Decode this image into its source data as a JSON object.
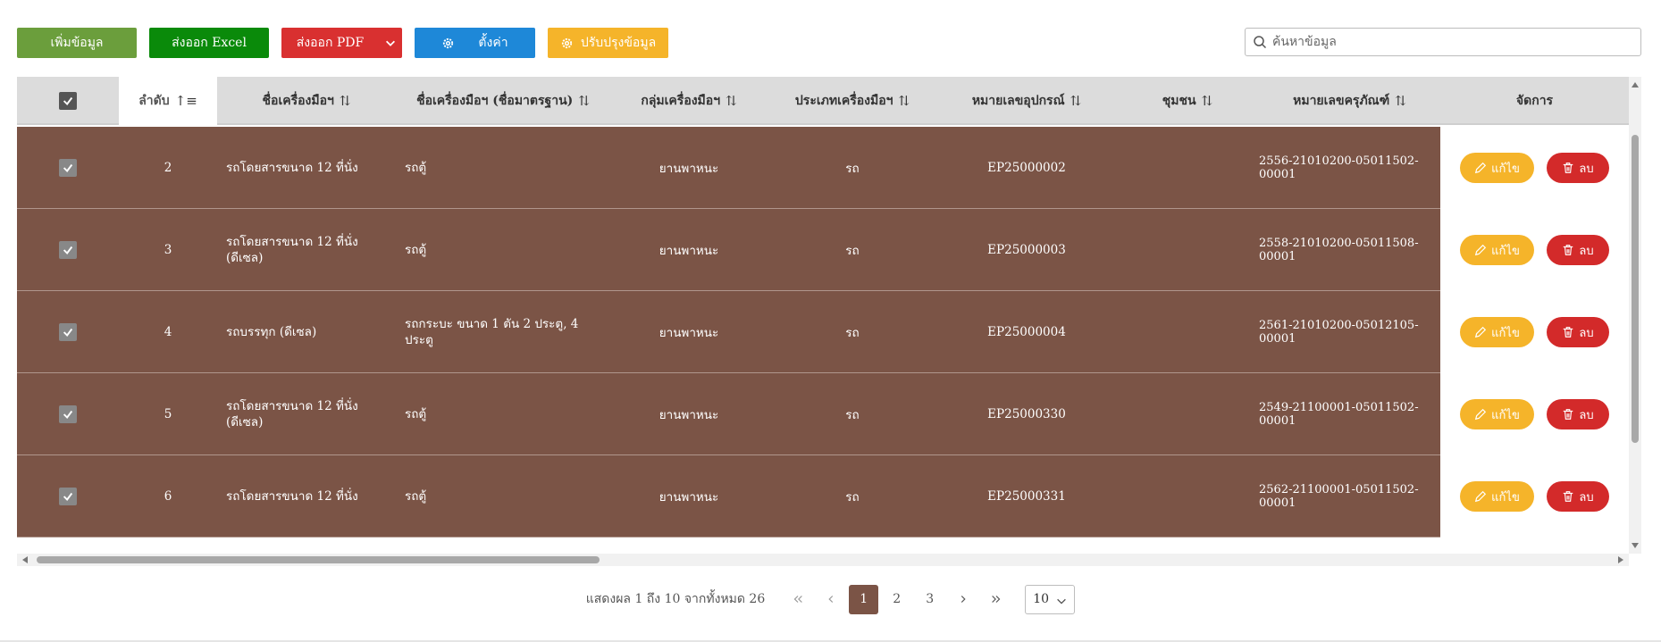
{
  "toolbar": {
    "add_label": "เพิ่มข้อมูล",
    "excel_label": "ส่งออก Excel",
    "pdf_label": "ส่งออก PDF",
    "settings_label": "ตั้งค่า",
    "update_label": "ปรับปรุงข้อมูล"
  },
  "search": {
    "placeholder": "ค้นหาข้อมูล"
  },
  "table": {
    "headers": {
      "order": "ลำดับ",
      "name": "ชื่อเครื่องมือฯ",
      "std_name": "ชื่อเครื่องมือฯ (ชื่อมาตรฐาน)",
      "group": "กลุ่มเครื่องมือฯ",
      "type": "ประเภทเครื่องมือฯ",
      "equip_no": "หมายเลขอุปกรณ์",
      "community": "ชุมชน",
      "asset_no": "หมายเลขครุภัณฑ์",
      "manage": "จัดการ"
    },
    "rows": [
      {
        "order": "2",
        "name": "รถโดยสารขนาด 12 ที่นั่ง",
        "std_name": "รถตู้",
        "group": "ยานพาหนะ",
        "type": "รถ",
        "equip_no": "EP25000002",
        "community": "",
        "asset_no": "2556-21010200-05011502-00001"
      },
      {
        "order": "3",
        "name": "รถโดยสารขนาด 12 ที่นั่ง (ดีเซล)",
        "std_name": "รถตู้",
        "group": "ยานพาหนะ",
        "type": "รถ",
        "equip_no": "EP25000003",
        "community": "",
        "asset_no": "2558-21010200-05011508-00001"
      },
      {
        "order": "4",
        "name": "รถบรรทุก (ดีเซล)",
        "std_name": "รถกระบะ ขนาด 1 ตัน 2 ประตู, 4 ประตู",
        "group": "ยานพาหนะ",
        "type": "รถ",
        "equip_no": "EP25000004",
        "community": "",
        "asset_no": "2561-21010200-05012105-00001"
      },
      {
        "order": "5",
        "name": "รถโดยสารขนาด 12 ที่นั่ง (ดีเซล)",
        "std_name": "รถตู้",
        "group": "ยานพาหนะ",
        "type": "รถ",
        "equip_no": "EP25000330",
        "community": "",
        "asset_no": "2549-21100001-05011502-00001"
      },
      {
        "order": "6",
        "name": "รถโดยสารขนาด 12 ที่นั่ง",
        "std_name": "รถตู้",
        "group": "ยานพาหนะ",
        "type": "รถ",
        "equip_no": "EP25000331",
        "community": "",
        "asset_no": "2562-21100001-05011502-00001"
      }
    ],
    "edit_label": "แก้ไข",
    "delete_label": "ลบ"
  },
  "pagination": {
    "info": "แสดงผล 1 ถึง 10 จากทั้งหมด 26",
    "pages": [
      "1",
      "2",
      "3"
    ],
    "current": "1",
    "page_size": "10"
  },
  "colors": {
    "row_highlight": "#7b5446",
    "add": "#6b9e3c",
    "excel": "#0a8a0a",
    "pdf": "#d93030",
    "settings": "#1e88d8",
    "update": "#f5b42a",
    "delete": "#d32a2a"
  },
  "icons": {
    "pdf_caret": "chevron-down-icon",
    "settings": "gear-icon",
    "update": "gear-icon",
    "search": "search-icon",
    "edit": "pencil-icon",
    "delete": "trash-icon",
    "checkbox": "check-icon"
  }
}
